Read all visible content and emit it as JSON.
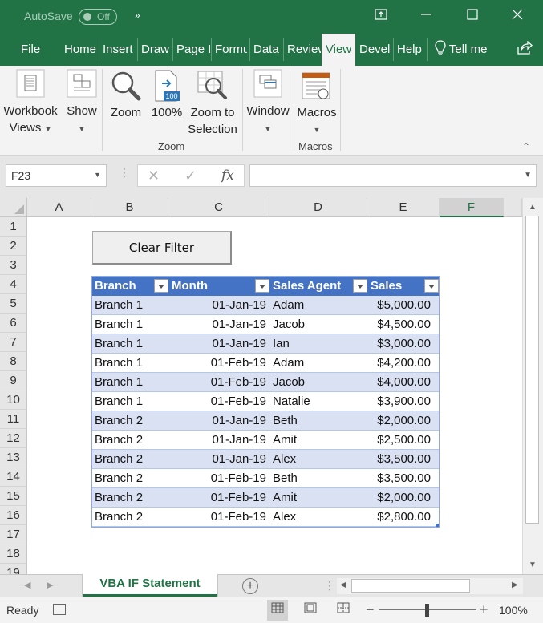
{
  "titlebar": {
    "autosave_label": "AutoSave",
    "autosave_state": "Off",
    "more_icon": "double-chevron-right-icon",
    "restore_icon": "ribbon-display-icon",
    "minimize_icon": "minimize-icon",
    "maximize_icon": "maximize-icon",
    "close_icon": "close-icon"
  },
  "tabs": [
    "File",
    "Home",
    "Insert",
    "Draw",
    "Page Layout",
    "Formulas",
    "Data",
    "Review",
    "View",
    "Developer",
    "Help"
  ],
  "active_tab": "View",
  "tell_me": "Tell me",
  "ribbon": {
    "workbook_views": [
      "Workbook",
      "Views"
    ],
    "show": "Show",
    "zoom": "Zoom",
    "zoom100": "100%",
    "zoom100_badge": "100",
    "zoom_selection": [
      "Zoom to",
      "Selection"
    ],
    "window": "Window",
    "macros": "Macros",
    "group_zoom": "Zoom",
    "group_macros": "Macros"
  },
  "formula_bar": {
    "name_box": "F23",
    "fx": "fx",
    "cancel": "✕",
    "enter": "✓",
    "formula": ""
  },
  "columns": [
    "A",
    "B",
    "C",
    "D",
    "E",
    "F"
  ],
  "selected_column": "F",
  "rows": [
    "1",
    "2",
    "3",
    "4",
    "5",
    "6",
    "7",
    "8",
    "9",
    "10",
    "11",
    "12",
    "13",
    "14",
    "15",
    "16",
    "17",
    "18",
    "19"
  ],
  "clear_filter_label": "Clear Filter",
  "table": {
    "headers": [
      "Branch",
      "Month",
      "Sales Agent",
      "Sales"
    ],
    "rows": [
      [
        "Branch 1",
        "01-Jan-19",
        "Adam",
        "$5,000.00"
      ],
      [
        "Branch 1",
        "01-Jan-19",
        "Jacob",
        "$4,500.00"
      ],
      [
        "Branch 1",
        "01-Jan-19",
        "Ian",
        "$3,000.00"
      ],
      [
        "Branch 1",
        "01-Feb-19",
        "Adam",
        "$4,200.00"
      ],
      [
        "Branch 1",
        "01-Feb-19",
        "Jacob",
        "$4,000.00"
      ],
      [
        "Branch 1",
        "01-Feb-19",
        "Natalie",
        "$3,900.00"
      ],
      [
        "Branch 2",
        "01-Jan-19",
        "Beth",
        "$2,000.00"
      ],
      [
        "Branch 2",
        "01-Jan-19",
        "Amit",
        "$2,500.00"
      ],
      [
        "Branch 2",
        "01-Jan-19",
        "Alex",
        "$3,500.00"
      ],
      [
        "Branch 2",
        "01-Feb-19",
        "Beth",
        "$3,500.00"
      ],
      [
        "Branch 2",
        "01-Feb-19",
        "Amit",
        "$2,000.00"
      ],
      [
        "Branch 2",
        "01-Feb-19",
        "Alex",
        "$2,800.00"
      ]
    ]
  },
  "sheet_tab": "VBA IF Statement",
  "status": {
    "ready": "Ready",
    "zoom": "100%",
    "zoom_minus": "−",
    "zoom_plus": "+"
  },
  "colors": {
    "excel_green": "#217346",
    "table_header": "#4472c4",
    "table_band": "#d9e1f2"
  }
}
